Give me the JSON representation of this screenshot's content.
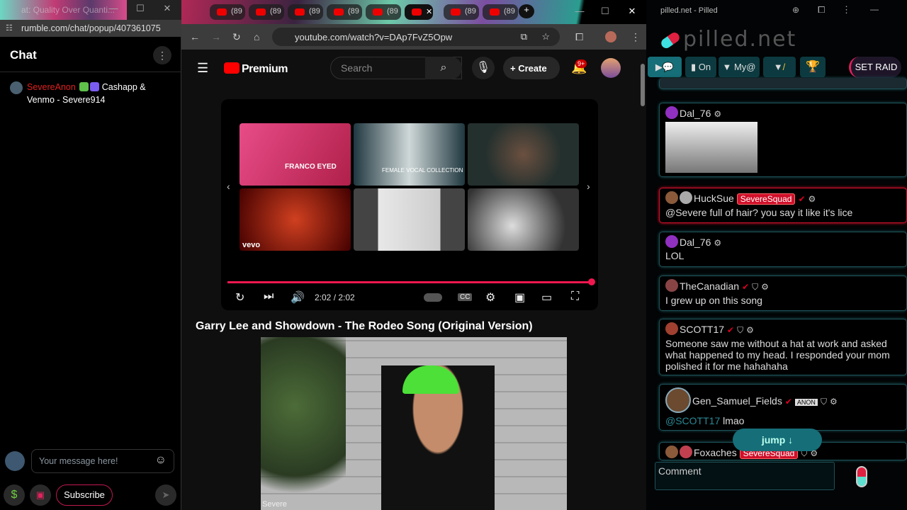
{
  "left": {
    "window_title": "at: Quality Over Quanti...",
    "url": "rumble.com/chat/popup/407361075",
    "chat_title": "Chat",
    "message": {
      "user": "SevereAnon",
      "text": "Cashapp & Venmo - Severe914"
    },
    "input_placeholder": "Your message here!",
    "subscribe_label": "Subscribe"
  },
  "browser": {
    "tabs": [
      "(89",
      "(89",
      "(89",
      "(89",
      "(89",
      "",
      "(89",
      "(89"
    ],
    "active_tab_index": 5,
    "url": "youtube.com/watch?v=DAp7FvZ5Opw"
  },
  "youtube": {
    "logo": "Premium",
    "search_placeholder": "Search",
    "create_label": "Create",
    "notifications": "9+",
    "player": {
      "time": "2:02 / 2:02",
      "progress_percent": 100
    },
    "video_title": "Garry Lee and Showdown - The Rodeo Song (Original Version)",
    "thumbnail_labels": [
      "FRANCO EYED",
      "FEMALE VOCAL COLLECTION",
      "",
      "vevo",
      "",
      ""
    ],
    "webcam_label": "Severe"
  },
  "pilled": {
    "window_title": "pilled.net - Pilled",
    "logo": "pilled.net",
    "toolbar": {
      "on_label": "On",
      "my_label": "My@",
      "raid_label": "SET RAID"
    },
    "messages": [
      {
        "user": "Dal_76",
        "text": ""
      },
      {
        "user": "HuckSue",
        "badge": "SevereSquad",
        "text": "@Severe full of hair? you say it like it's lice",
        "highlight": true
      },
      {
        "user": "Dal_76",
        "text": "LOL"
      },
      {
        "user": "TheCanadian",
        "text": "I grew up on this song"
      },
      {
        "user": "SCOTT17",
        "text": "Someone saw me without a hat at work and asked what happened to my head. I responded your mom polished it for me hahahaha"
      },
      {
        "user": "Gen_Samuel_Fields",
        "mention": "@SCOTT17",
        "text": "lmao"
      },
      {
        "user": "Foxaches",
        "badge": "SevereSquad",
        "text": ""
      }
    ],
    "jump_label": "jump ↓",
    "comment_placeholder": "Comment"
  },
  "colors": {
    "youtube_red": "#ff0000",
    "progress": "#f0174f",
    "pilled_teal": "#156e78",
    "rumble_name": "#e02020"
  }
}
